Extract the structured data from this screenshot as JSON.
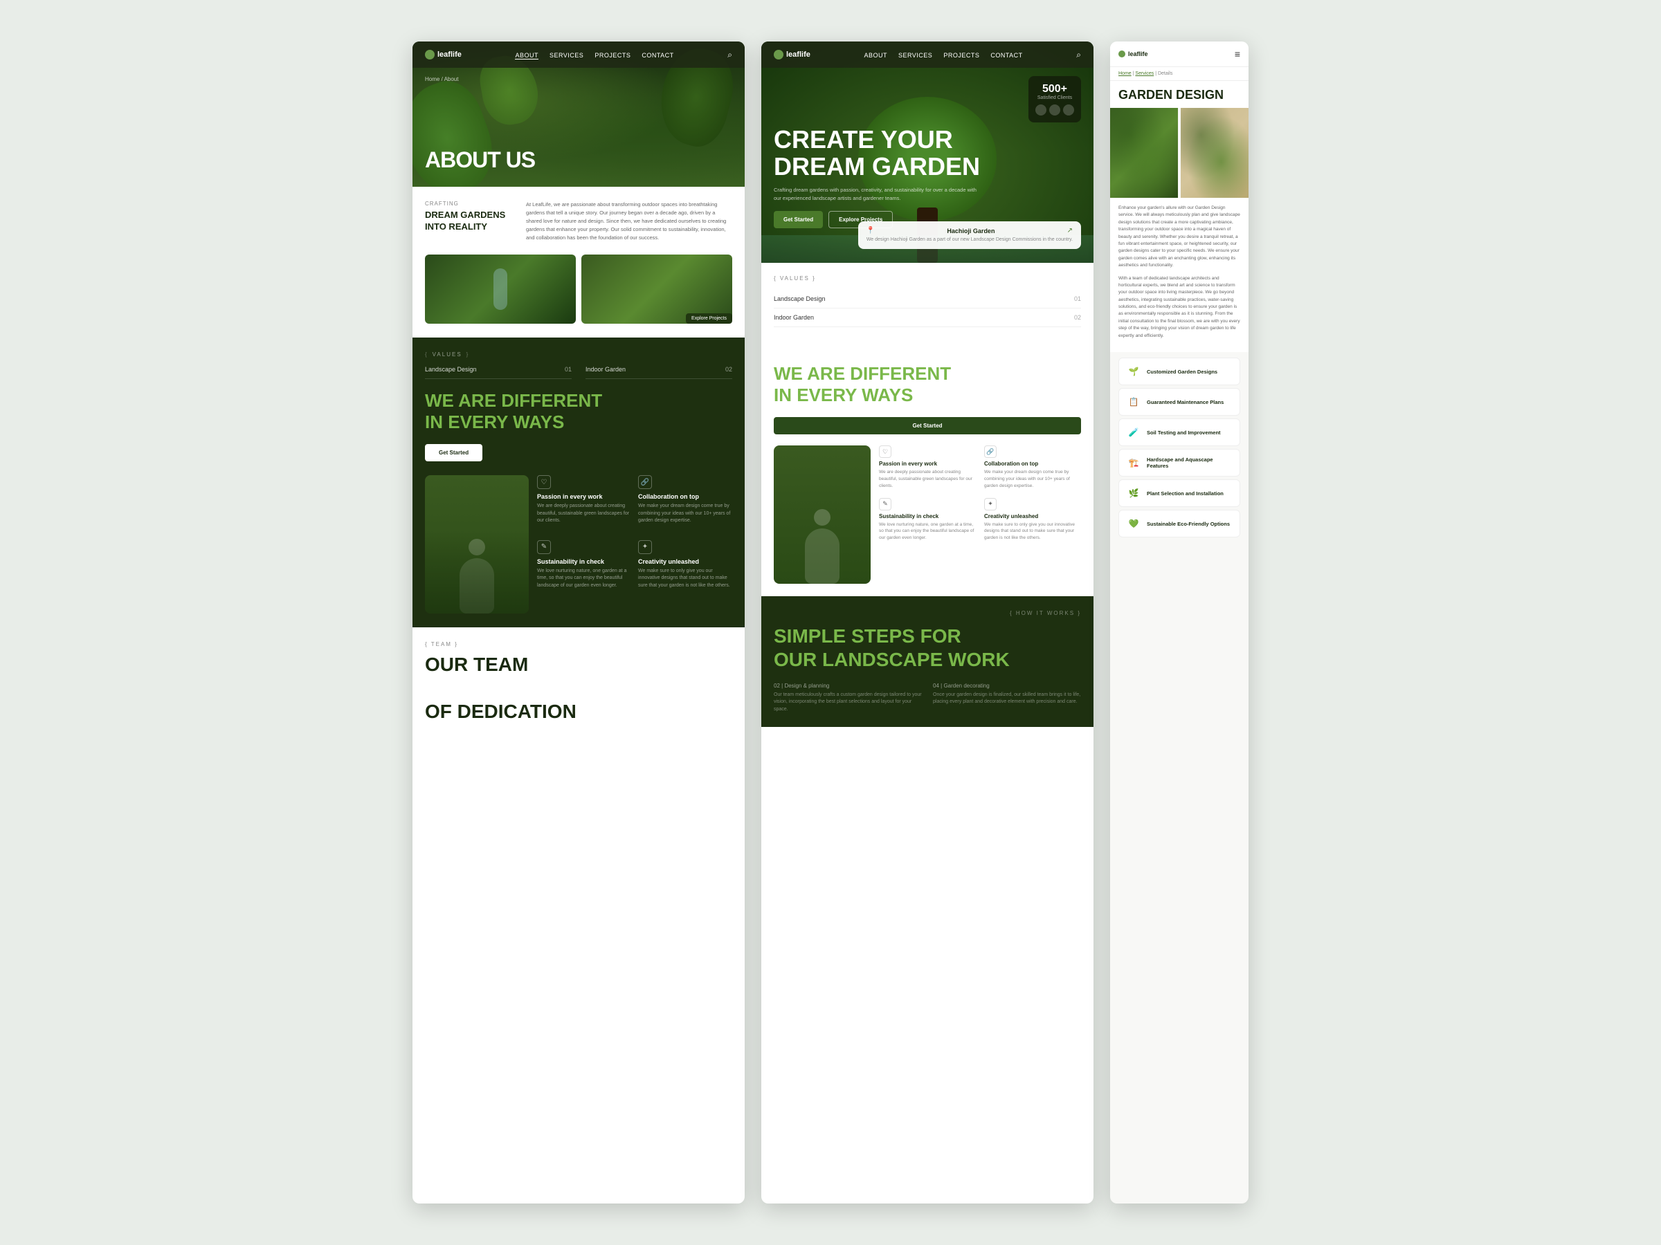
{
  "brand": {
    "name": "leaflife",
    "logo_symbol": "🌿"
  },
  "panel_about": {
    "nav": {
      "logo": "leaflife",
      "links": [
        "ABOUT",
        "SERVICES",
        "PROJECTS",
        "CONTACT"
      ],
      "active_link": "ABOUT"
    },
    "breadcrumb": "Home / About",
    "hero_title": "ABOUT US",
    "crafting": {
      "label": "CRAFTING",
      "title": "DREAM GARDENS\nINTO REALITY",
      "description": "At LeafLife, we are passionate about transforming outdoor spaces into breathtaking gardens that tell a unique story. Our journey began over a decade ago, driven by a shared love for nature and design. Since then, we have dedicated ourselves to creating gardens that enhance your property. Our solid commitment to sustainability, innovation, and collaboration has been the foundation of our success."
    },
    "explore_btn": "Explore Projects",
    "values_label": "VALUES",
    "services": [
      {
        "name": "Landscape Design",
        "num": "01"
      },
      {
        "name": "Indoor Garden",
        "num": "02"
      }
    ],
    "different_title_prefix": "WE ARE",
    "different_title_highlight": "DIFFERENT",
    "different_subtitle": "IN EVERY WAYS",
    "get_started": "Get Started",
    "features": [
      {
        "icon": "♡",
        "title": "Passion in every work",
        "desc": "We are deeply passionate about creating beautiful, sustainable green landscapes for our clients."
      },
      {
        "icon": "🔗",
        "title": "Collaboration on top",
        "desc": "We make your dream design come true by combining your ideas with our 10+ years of garden design expertise."
      },
      {
        "icon": "✎",
        "title": "Sustainability in check",
        "desc": "We love nurturing nature, one garden at a time, so that you can enjoy the beautiful landscape of our garden even longer."
      },
      {
        "icon": "✦",
        "title": "Creativity unleashed",
        "desc": "We make sure to only give you our innovative designs that stand out to make sure that your garden is not like the others."
      }
    ],
    "team_label": "TEAM",
    "team_title_line1": "OUR TEAM",
    "team_title_line2": "OF DEDICATION"
  },
  "panel_main": {
    "nav": {
      "logo": "leaflife",
      "links": [
        "ABOUT",
        "SERVICES",
        "PROJECTS",
        "CONTACT"
      ]
    },
    "hero": {
      "title_line1": "CREATE YOUR",
      "title_line2": "DREAM GARDEN",
      "subtitle": "Crafting dream gardens with passion, creativity, and sustainability for over a decade with our experienced landscape artists and gardener teams.",
      "btn_primary": "Get Started",
      "btn_secondary": "Explore Projects",
      "badge_num": "500+",
      "badge_label": "Satisfied Clients",
      "location_name": "Hachioji Garden",
      "location_desc": "We design Hachioji Garden as a part of our new Landscape Design Commissions in the country."
    },
    "values_label": "VALUES",
    "services": [
      {
        "name": "Landscape Design",
        "num": "01"
      },
      {
        "name": "Indoor Garden",
        "num": "02"
      }
    ],
    "different": {
      "title_prefix": "WE ARE",
      "title_highlight": "DIFFERENT",
      "subtitle": "IN EVERY WAYS",
      "get_started": "Get Started",
      "features": [
        {
          "icon": "♡",
          "title": "Passion in every work",
          "desc": "We are deeply passionate about creating beautiful, sustainable green landscapes for our clients."
        },
        {
          "icon": "🔗",
          "title": "Collaboration on top",
          "desc": "We make your dream design come true by combining your ideas with our 10+ years of garden design expertise."
        },
        {
          "icon": "✎",
          "title": "Sustainability in check",
          "desc": "We love nurturing nature, one garden at a time, so that you can enjoy the beautiful landscape of our garden even longer."
        },
        {
          "icon": "✦",
          "title": "Creativity unleashed",
          "desc": "We make sure to only give you our innovative designs that stand out to make sure that your garden is not like the others."
        }
      ]
    },
    "steps": {
      "how_it_works": "HOW IT WORKS",
      "title_prefix": "SIMPLE STEPS FOR",
      "title_line2_prefix": "OUR",
      "title_line2_highlight": "LANDSCAPE",
      "title_line2_suffix": "WORK",
      "items": [
        {
          "num": "02",
          "label": "Design & planning",
          "desc": "Our team meticulously crafts a custom garden design tailored to your vision, incorporating the best plant selections and layout for your space."
        },
        {
          "num": "04",
          "label": "Garden decorating",
          "desc": "Once your garden design is finalized, our skilled team brings it to life, placing every plant and decorative element with precision and care."
        }
      ]
    }
  },
  "panel_mobile": {
    "nav": {
      "logo": "leaflife",
      "menu_icon": "≡"
    },
    "breadcrumb": {
      "home": "Home",
      "services": "Services",
      "details": "Details"
    },
    "page_title": "GARDEN DESIGN",
    "description_1": "Enhance your garden's allure with our Garden Design service. We will always meticulously plan and give landscape design solutions that create a more captivating ambiance, transforming your outdoor space into a magical haven of beauty and serenity. Whether you desire a tranquil retreat, a fun vibrant entertainment space, or heightened security, our garden designs cater to your specific needs. We ensure your garden comes alive with an enchanting glow, enhancing its aesthetics and functionality.",
    "description_2": "With a team of dedicated landscape architects and horticultural experts, we blend art and science to transform your outdoor space into living masterpiece. We go beyond aesthetics, integrating sustainable practices, water-saving solutions, and eco-friendly choices to ensure your garden is as environmentally responsible as it is stunning. From the initial consultation to the final blossom, we are with you every step of the way, bringing your vision of dream garden to life expertly and efficiently.",
    "services": [
      {
        "icon": "🌱",
        "name": "Customized Garden Designs"
      },
      {
        "icon": "📋",
        "name": "Guaranteed Maintenance Plans"
      },
      {
        "icon": "🧪",
        "name": "Soil Testing and Improvement"
      },
      {
        "icon": "🏗️",
        "name": "Hardscape and Aquascape Features"
      },
      {
        "icon": "🌿",
        "name": "Plant Selection and Installation"
      },
      {
        "icon": "💚",
        "name": "Sustainable Eco-Friendly Options"
      }
    ]
  }
}
